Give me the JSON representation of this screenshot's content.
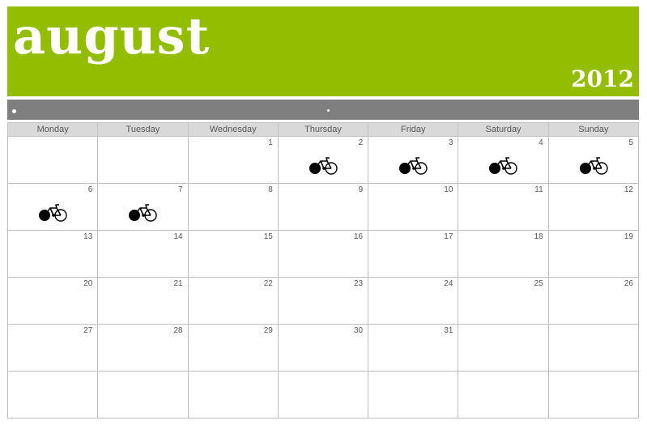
{
  "header": {
    "month": "august",
    "year": "2012"
  },
  "colors": {
    "banner": "#93bd00",
    "bar": "#7f7f7f",
    "weekday_header": "#d9d9d9"
  },
  "weekdays": [
    "Monday",
    "Tuesday",
    "Wednesday",
    "Thursday",
    "Friday",
    "Saturday",
    "Sunday"
  ],
  "weeks": [
    [
      {
        "day": ""
      },
      {
        "day": ""
      },
      {
        "day": "1"
      },
      {
        "day": "2",
        "icon": "bicycle-icon"
      },
      {
        "day": "3",
        "icon": "bicycle-icon"
      },
      {
        "day": "4",
        "icon": "bicycle-icon"
      },
      {
        "day": "5",
        "icon": "bicycle-icon"
      }
    ],
    [
      {
        "day": "6",
        "icon": "bicycle-icon"
      },
      {
        "day": "7",
        "icon": "bicycle-icon"
      },
      {
        "day": "8"
      },
      {
        "day": "9"
      },
      {
        "day": "10"
      },
      {
        "day": "11"
      },
      {
        "day": "12"
      }
    ],
    [
      {
        "day": "13"
      },
      {
        "day": "14"
      },
      {
        "day": "15"
      },
      {
        "day": "16"
      },
      {
        "day": "17"
      },
      {
        "day": "18"
      },
      {
        "day": "19"
      }
    ],
    [
      {
        "day": "20"
      },
      {
        "day": "21"
      },
      {
        "day": "22"
      },
      {
        "day": "23"
      },
      {
        "day": "24"
      },
      {
        "day": "25"
      },
      {
        "day": "26"
      }
    ],
    [
      {
        "day": "27"
      },
      {
        "day": "28"
      },
      {
        "day": "29"
      },
      {
        "day": "30"
      },
      {
        "day": "31"
      },
      {
        "day": ""
      },
      {
        "day": ""
      }
    ],
    [
      {
        "day": ""
      },
      {
        "day": ""
      },
      {
        "day": ""
      },
      {
        "day": ""
      },
      {
        "day": ""
      },
      {
        "day": ""
      },
      {
        "day": ""
      }
    ]
  ]
}
